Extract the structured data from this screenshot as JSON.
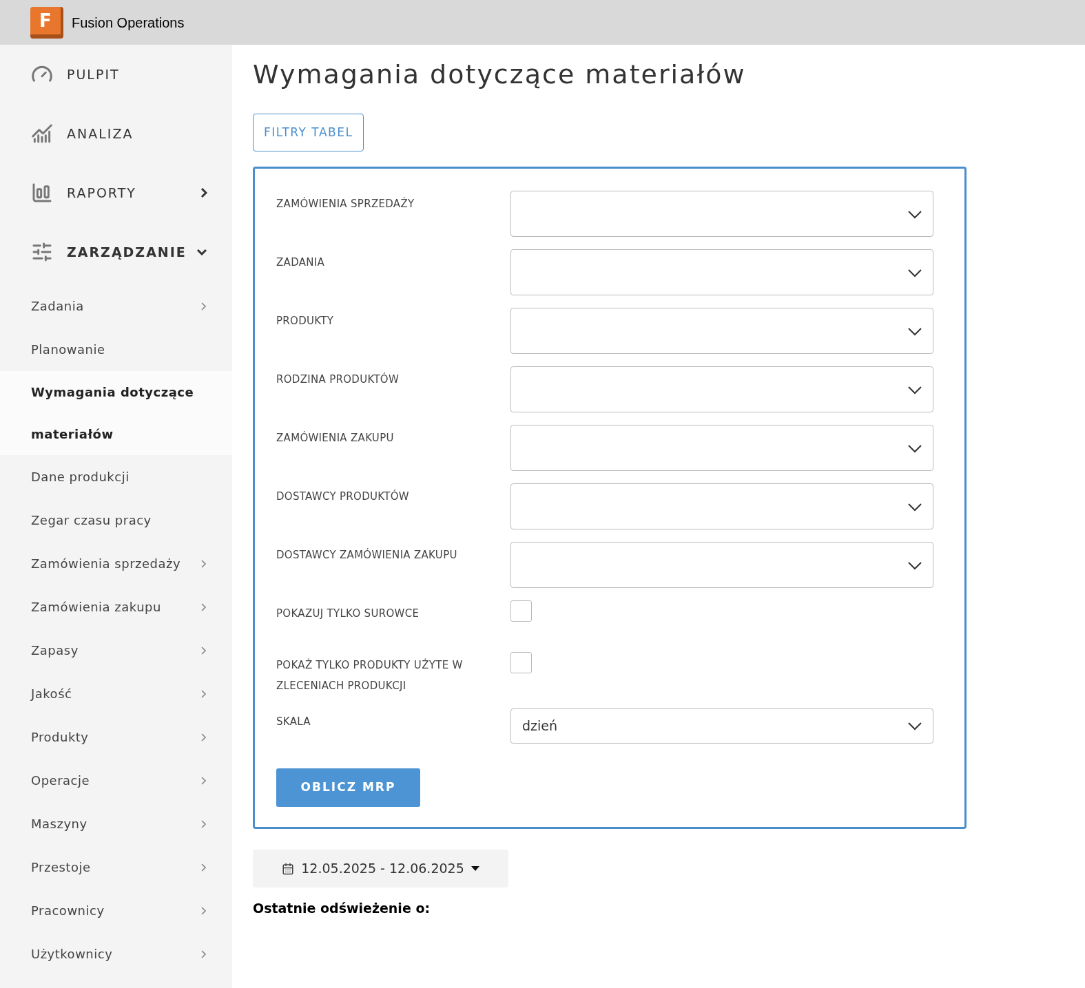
{
  "header": {
    "logo_letter": "F",
    "title": "Fusion Operations"
  },
  "sidebar": {
    "sections": [
      {
        "label": "PULPIT",
        "expandable": false,
        "expanded": false
      },
      {
        "label": "ANALIZA",
        "expandable": false,
        "expanded": false
      },
      {
        "label": "RAPORTY",
        "expandable": true,
        "expanded": false
      },
      {
        "label": "ZARZĄDZANIE",
        "expandable": true,
        "expanded": true
      }
    ],
    "items": [
      {
        "label": "Zadania",
        "submenu": true,
        "selected": false
      },
      {
        "label": "Planowanie",
        "submenu": false,
        "selected": false
      },
      {
        "label": "Wymagania dotyczące materiałów",
        "submenu": false,
        "selected": true
      },
      {
        "label": "Dane produkcji",
        "submenu": false,
        "selected": false
      },
      {
        "label": "Zegar czasu pracy",
        "submenu": false,
        "selected": false
      },
      {
        "label": "Zamówienia sprzedaży",
        "submenu": true,
        "selected": false
      },
      {
        "label": "Zamówienia zakupu",
        "submenu": true,
        "selected": false
      },
      {
        "label": "Zapasy",
        "submenu": true,
        "selected": false
      },
      {
        "label": "Jakość",
        "submenu": true,
        "selected": false
      },
      {
        "label": "Produkty",
        "submenu": true,
        "selected": false
      },
      {
        "label": "Operacje",
        "submenu": true,
        "selected": false
      },
      {
        "label": "Maszyny",
        "submenu": true,
        "selected": false
      },
      {
        "label": "Przestoje",
        "submenu": true,
        "selected": false
      },
      {
        "label": "Pracownicy",
        "submenu": true,
        "selected": false
      },
      {
        "label": "Użytkownicy",
        "submenu": true,
        "selected": false
      }
    ]
  },
  "page": {
    "title": "Wymagania dotyczące materiałów",
    "filters_button": "FILTRY TABEL",
    "form": {
      "fields": [
        {
          "kind": "select",
          "label": "ZAMÓWIENIA SPRZEDAŻY"
        },
        {
          "kind": "select",
          "label": "ZADANIA"
        },
        {
          "kind": "select",
          "label": "PRODUKTY"
        },
        {
          "kind": "select",
          "label": "RODZINA PRODUKTÓW"
        },
        {
          "kind": "select",
          "label": "ZAMÓWIENIA ZAKUPU"
        },
        {
          "kind": "select",
          "label": "DOSTAWCY PRODUKTÓW"
        },
        {
          "kind": "select",
          "label": "DOSTAWCY ZAMÓWIENIA ZAKUPU"
        },
        {
          "kind": "checkbox",
          "label": "POKAZUJ TYLKO SUROWCE",
          "checked": false
        },
        {
          "kind": "checkbox",
          "label": "POKAŻ TYLKO PRODUKTY UŻYTE W ZLECENIACH PRODUKCJI",
          "checked": false
        },
        {
          "kind": "value_select",
          "label": "SKALA",
          "value": "dzień"
        }
      ],
      "submit": "OBLICZ MRP"
    },
    "date_range": "12.05.2025 - 12.06.2025",
    "last_refresh": "Ostatnie odświeżenie o:"
  }
}
